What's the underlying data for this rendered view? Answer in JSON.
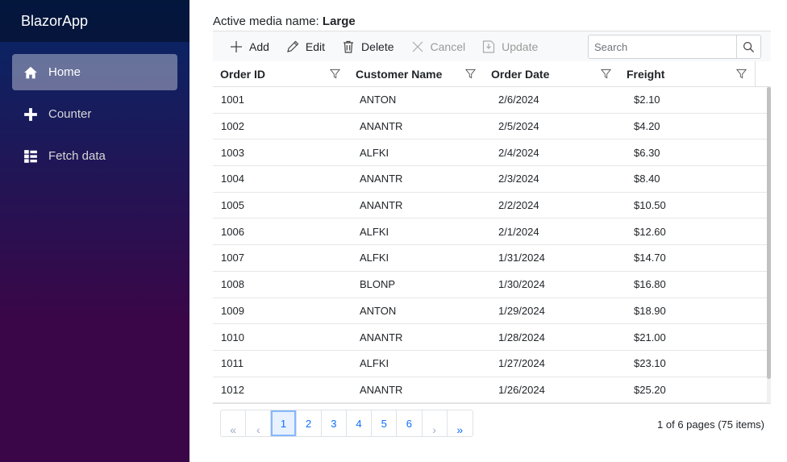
{
  "app": {
    "brand": "BlazorApp"
  },
  "sidebar": {
    "items": [
      {
        "label": "Home",
        "icon": "home-icon",
        "active": true
      },
      {
        "label": "Counter",
        "icon": "plus-icon",
        "active": false
      },
      {
        "label": "Fetch data",
        "icon": "list-icon",
        "active": false
      }
    ]
  },
  "main": {
    "media_label": "Active media name: ",
    "media_value": "Large"
  },
  "toolbar": {
    "add": "Add",
    "edit": "Edit",
    "delete": "Delete",
    "cancel": "Cancel",
    "update": "Update",
    "search_placeholder": "Search"
  },
  "grid": {
    "columns": [
      "Order ID",
      "Customer Name",
      "Order Date",
      "Freight"
    ],
    "rows": [
      [
        "1001",
        "ANTON",
        "2/6/2024",
        "$2.10"
      ],
      [
        "1002",
        "ANANTR",
        "2/5/2024",
        "$4.20"
      ],
      [
        "1003",
        "ALFKI",
        "2/4/2024",
        "$6.30"
      ],
      [
        "1004",
        "ANANTR",
        "2/3/2024",
        "$8.40"
      ],
      [
        "1005",
        "ANANTR",
        "2/2/2024",
        "$10.50"
      ],
      [
        "1006",
        "ALFKI",
        "2/1/2024",
        "$12.60"
      ],
      [
        "1007",
        "ALFKI",
        "1/31/2024",
        "$14.70"
      ],
      [
        "1008",
        "BLONP",
        "1/30/2024",
        "$16.80"
      ],
      [
        "1009",
        "ANTON",
        "1/29/2024",
        "$18.90"
      ],
      [
        "1010",
        "ANANTR",
        "1/28/2024",
        "$21.00"
      ],
      [
        "1011",
        "ALFKI",
        "1/27/2024",
        "$23.10"
      ],
      [
        "1012",
        "ANANTR",
        "1/26/2024",
        "$25.20"
      ]
    ]
  },
  "pager": {
    "first": "«",
    "prev": "‹",
    "next": "›",
    "last": "»",
    "pages": [
      "1",
      "2",
      "3",
      "4",
      "5",
      "6"
    ],
    "current": "1",
    "info": "1 of 6 pages (75 items)"
  },
  "colors": {
    "accent": "#0d6efd",
    "sidebar_top": "#052767",
    "sidebar_bottom": "#3a0647"
  }
}
